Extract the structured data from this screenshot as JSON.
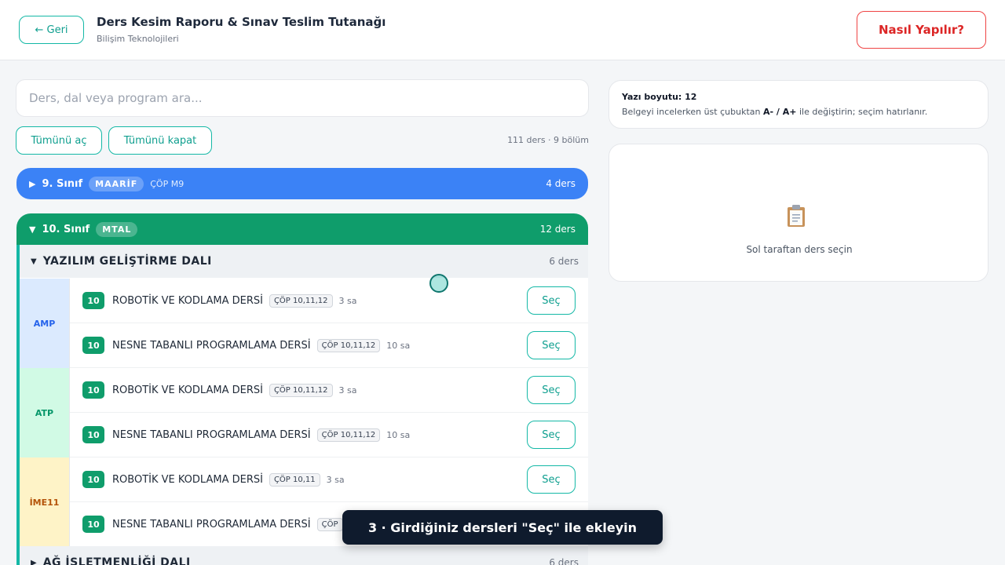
{
  "header": {
    "back_label": "← Geri",
    "title": "Ders Kesim Raporu & Sınav Teslim Tutanağı",
    "subtitle": "Bilişim Teknolojileri",
    "help_label": "Nasıl Yapılır?"
  },
  "search": {
    "placeholder": "Ders, dal veya program ara..."
  },
  "controls": {
    "expand_all": "Tümünü aç",
    "collapse_all": "Tümünü kapat",
    "summary": "111 ders · 9 bölüm"
  },
  "grades": [
    {
      "caret": "▶",
      "name": "9. Sınıf",
      "badge": "MAARİF",
      "code": "ÇÖP M9",
      "count": "4 ders"
    },
    {
      "caret": "▼",
      "name": "10. Sınıf",
      "badge": "MTAL",
      "code": "",
      "count": "12 ders"
    }
  ],
  "dals": [
    {
      "caret": "▼",
      "name": "YAZILIM GELİŞTİRME DALI",
      "count": "6 ders"
    },
    {
      "caret": "▶",
      "name": "AĞ İŞLETMENLİĞİ DALI",
      "count": "6 ders"
    }
  ],
  "programs": [
    "AMP",
    "ATP",
    "İME11"
  ],
  "rows": [
    {
      "level": "10",
      "course": "ROBOTİK VE KODLAMA DERSİ",
      "cop": "ÇÖP 10,11,12",
      "hours": "3 sa",
      "action": "Seç"
    },
    {
      "level": "10",
      "course": "NESNE TABANLI PROGRAMLAMA DERSİ",
      "cop": "ÇÖP 10,11,12",
      "hours": "10 sa",
      "action": "Seç"
    },
    {
      "level": "10",
      "course": "ROBOTİK VE KODLAMA DERSİ",
      "cop": "ÇÖP 10,11,12",
      "hours": "3 sa",
      "action": "Seç"
    },
    {
      "level": "10",
      "course": "NESNE TABANLI PROGRAMLAMA DERSİ",
      "cop": "ÇÖP 10,11,12",
      "hours": "10 sa",
      "action": "Seç"
    },
    {
      "level": "10",
      "course": "ROBOTİK VE KODLAMA DERSİ",
      "cop": "ÇÖP 10,11",
      "hours": "3 sa",
      "action": "Seç"
    },
    {
      "level": "10",
      "course": "NESNE TABANLI PROGRAMLAMA DERSİ",
      "cop": "ÇÖP",
      "hours": "",
      "action": ""
    }
  ],
  "font_card": {
    "title": "Yazı boyutu: 12",
    "desc_before": "Belgeyi incelerken üst çubuktan ",
    "desc_keys": "A- / A+",
    "desc_after": " ile değiştirin; seçim hatırlanır."
  },
  "empty_state": {
    "icon": "clipboard-icon",
    "text": "Sol taraftan ders seçin"
  },
  "toast": {
    "text": "3 · Girdiğiniz dersleri \"Seç\" ile ekleyin"
  }
}
